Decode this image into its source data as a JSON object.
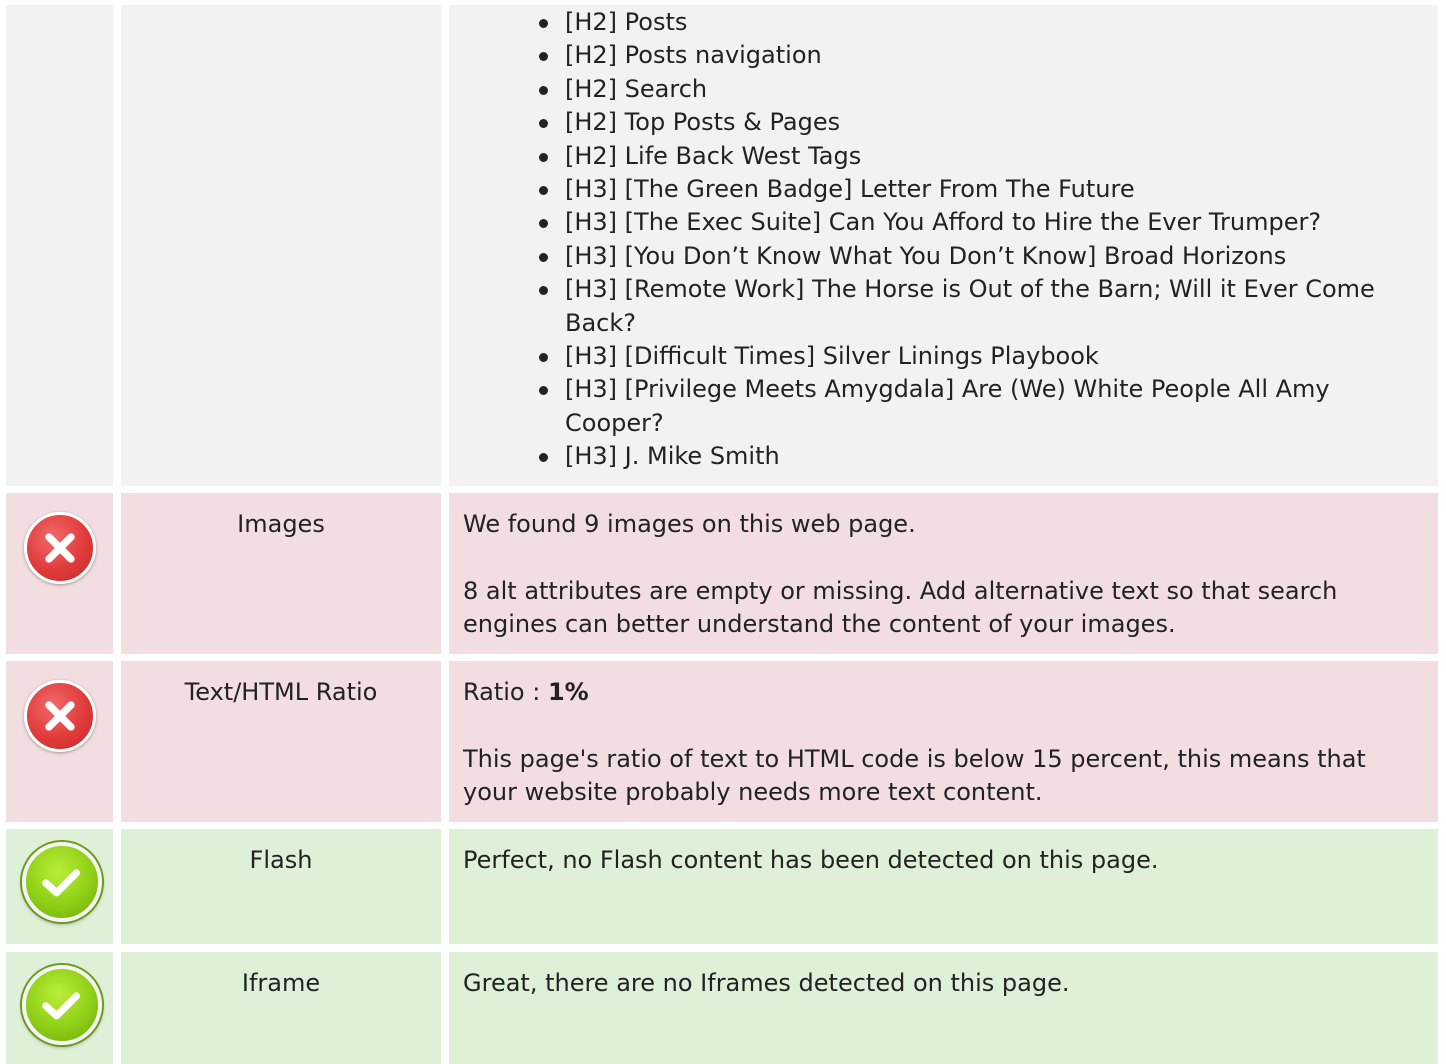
{
  "headings": {
    "items": [
      "[H2] Posts",
      "[H2] Posts navigation",
      "[H2] Search",
      "[H2] Top Posts & Pages",
      "[H2] Life Back West Tags",
      "[H3] [The Green Badge] Letter From The Future",
      "[H3] [The Exec Suite] Can You Afford to Hire the Ever Trumper?",
      "[H3] [You Don’t Know What You Don’t Know] Broad Horizons",
      "[H3] [Remote Work] The Horse is Out of the Barn; Will it Ever Come Back?",
      "[H3] [Difficult Times] Silver Linings Playbook",
      "[H3] [Privilege Meets Amygdala] Are (We) White People All Amy Cooper?",
      "[H3] J. Mike Smith"
    ]
  },
  "images": {
    "title": "Images",
    "status": "error",
    "line1": "We found 9 images on this web page.",
    "line2": "8 alt attributes are empty or missing. Add alternative text so that search engines can better understand the content of your images."
  },
  "ratio": {
    "title": "Text/HTML Ratio",
    "status": "error",
    "label": "Ratio : ",
    "value": "1%",
    "line2": "This page's ratio of text to HTML code is below 15 percent, this means that your website probably needs more text content."
  },
  "flash": {
    "title": "Flash",
    "status": "ok",
    "line1": "Perfect, no Flash content has been detected on this page."
  },
  "iframe": {
    "title": "Iframe",
    "status": "ok",
    "line1": "Great, there are no Iframes detected on this page."
  },
  "colors": {
    "neutral_bg": "#f2f2f2",
    "error_bg": "#f2dee0",
    "ok_bg": "#dff0d8",
    "error_icon": "#e03b3b",
    "ok_icon": "#8fcf16"
  },
  "icons": {
    "error": "error-x-icon",
    "ok": "checkmark-icon"
  }
}
